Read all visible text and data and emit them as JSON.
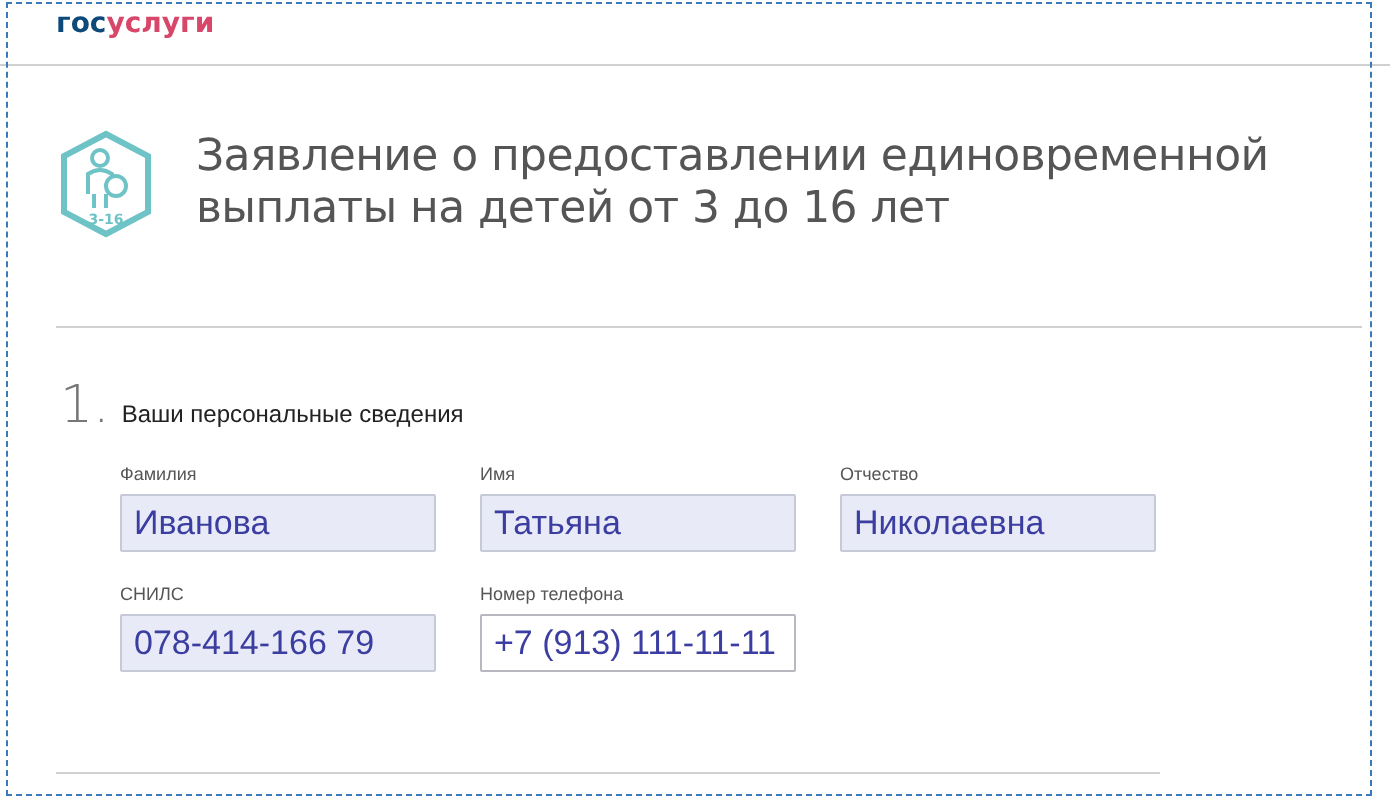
{
  "logo": {
    "part_1": "гос",
    "part_2": "услуги"
  },
  "service": {
    "badge": "3-16",
    "title": "Заявление о предоставлении единовременной выплаты на детей от 3 до 16 лет"
  },
  "section": {
    "number": "1.",
    "heading": "Ваши персональные сведения"
  },
  "fields": [
    {
      "label": "Фамилия",
      "value": "Иванова",
      "autofilled": true
    },
    {
      "label": "Имя",
      "value": "Татьяна",
      "autofilled": true
    },
    {
      "label": "Отчество",
      "value": "Николаевна",
      "autofilled": true
    },
    {
      "label": "СНИЛС",
      "value": "078-414-166 79",
      "autofilled": true
    },
    {
      "label": "Номер телефона",
      "value": "+7 (913) 111-11-11",
      "autofilled": false
    }
  ]
}
